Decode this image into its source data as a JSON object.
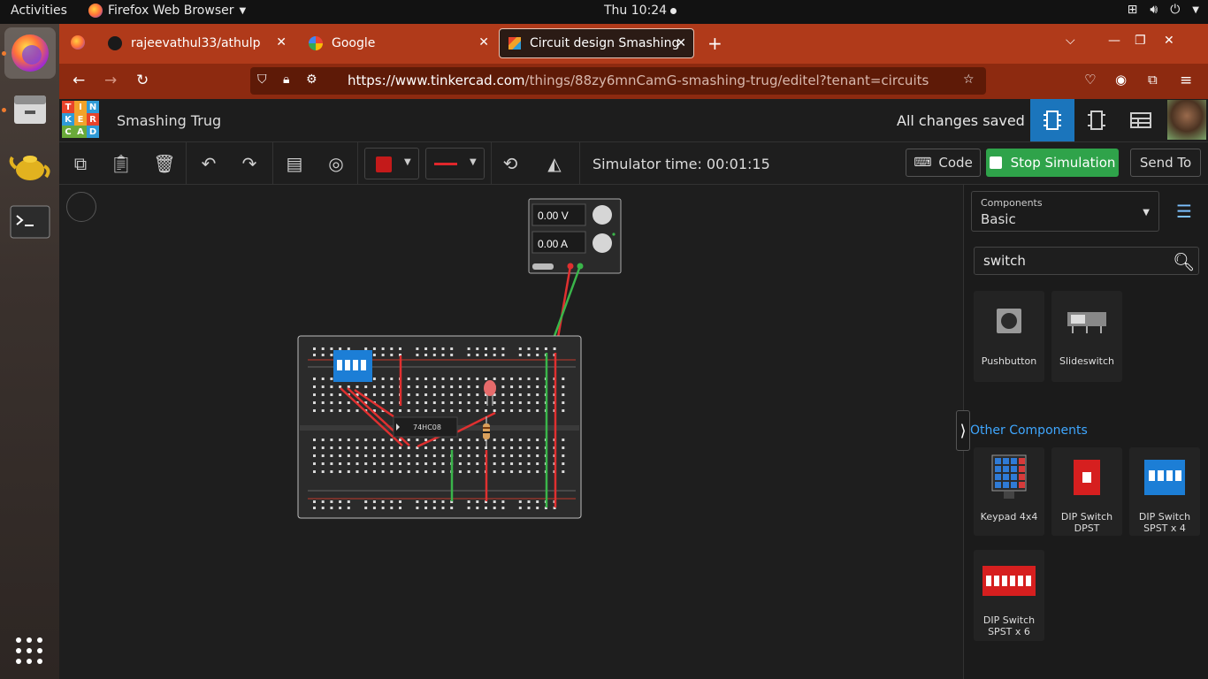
{
  "topbar": {
    "activities": "Activities",
    "app_name": "Firefox Web Browser",
    "clock": "Thu 10:24"
  },
  "browser": {
    "tabs": [
      {
        "label": "rajeevathul33/athulp"
      },
      {
        "label": "Google"
      },
      {
        "label": "Circuit design Smashing T"
      }
    ],
    "url_host": "https://www.tinkercad.com",
    "url_path": "/things/88zy6mnCamG-smashing-trug/editel?tenant=circuits"
  },
  "tinkercad": {
    "logo_letters": [
      "T",
      "I",
      "N",
      "K",
      "E",
      "R",
      "C",
      "A",
      "D"
    ],
    "logo_colors": [
      "#e8432b",
      "#f2a22a",
      "#2f9bd7",
      "#2f9bd7",
      "#f2a22a",
      "#e8432b",
      "#6aaa3a",
      "#6aaa3a",
      "#2f9bd7"
    ],
    "design_title": "Smashing Trug",
    "save_status": "All changes saved"
  },
  "toolbar": {
    "simulator_time": "Simulator time: 00:01:15",
    "code_label": "Code",
    "stop_label": "Stop Simulation",
    "send_label": "Send To",
    "fill_color": "#c41a1a",
    "wire_color": "#e0262b"
  },
  "power_supply": {
    "voltage": "0.00 V",
    "current": "0.00 A"
  },
  "chip_label": "74HC08",
  "panel": {
    "components_label": "Components",
    "components_value": "Basic",
    "search_value": "switch",
    "basic_items": [
      "Pushbutton",
      "Slideswitch"
    ],
    "other_title": "Other Components",
    "other_items": [
      "Keypad 4x4",
      "DIP Switch DPST",
      "DIP Switch SPST x 4",
      "DIP Switch SPST x 6"
    ]
  }
}
